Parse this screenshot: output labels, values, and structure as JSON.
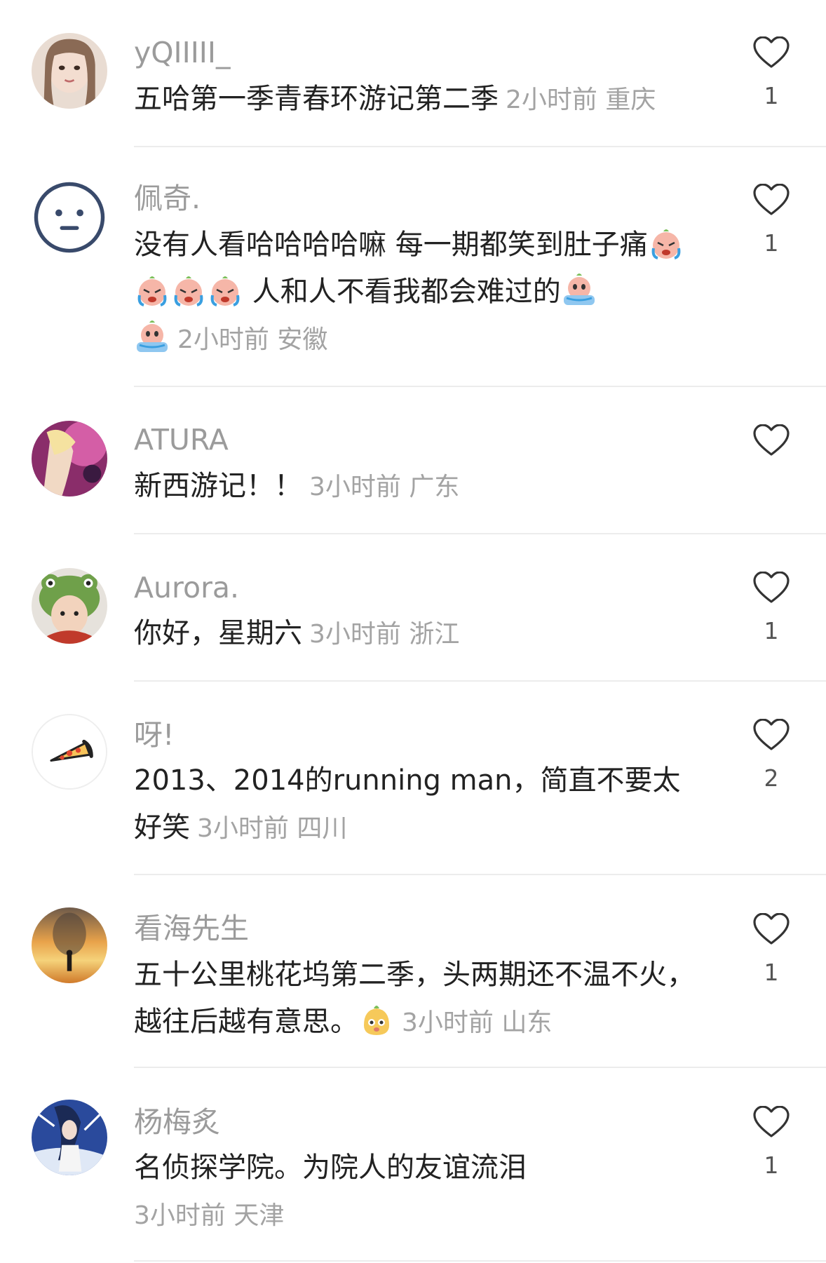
{
  "comments": [
    {
      "username": "yQIIIII_",
      "text": "五哈第一季青春环游记第二季",
      "time": "2小时前",
      "location": "重庆",
      "likes": "1",
      "avatar": "portrait-girl"
    },
    {
      "username": "佩奇.",
      "text_1": "没有人看哈哈哈哈嘛 每一期都笑到肚子痛",
      "text_2": " 人和人不看我都会难过的",
      "time": "2小时前",
      "location": "安徽",
      "likes": "1",
      "avatar": "face-icon",
      "emoji": "crying-emoji"
    },
    {
      "username": "ATURA",
      "text": "新西游记！！",
      "time": "3小时前",
      "location": "广东",
      "likes": "",
      "avatar": "concert-photo"
    },
    {
      "username": "Aurora.",
      "text": "你好，星期六",
      "time": "3小时前",
      "location": "浙江",
      "likes": "1",
      "avatar": "frog-hat-child"
    },
    {
      "username": "呀!",
      "text": "2013、2014的running man，简直不要太好笑",
      "time": "3小时前",
      "location": "四川",
      "likes": "2",
      "avatar": "pizza-icon"
    },
    {
      "username": "看海先生",
      "text": "五十公里桃花坞第二季，头两期还不温不火，越往后越有意思。",
      "time": "3小时前",
      "location": "山东",
      "likes": "1",
      "avatar": "sunset-silhouette",
      "emoji": "smiling-emoji"
    },
    {
      "username": "杨梅炙",
      "text": "名侦探学院。为院人的友谊流泪",
      "time": "3小时前",
      "location": "天津",
      "likes": "1",
      "avatar": "anime-girl"
    }
  ],
  "icons": {
    "like": "heart-outline-icon"
  },
  "colors": {
    "username": "#9b9b9b",
    "meta": "#a3a3a3",
    "text": "#222222",
    "divider": "#ececec"
  }
}
